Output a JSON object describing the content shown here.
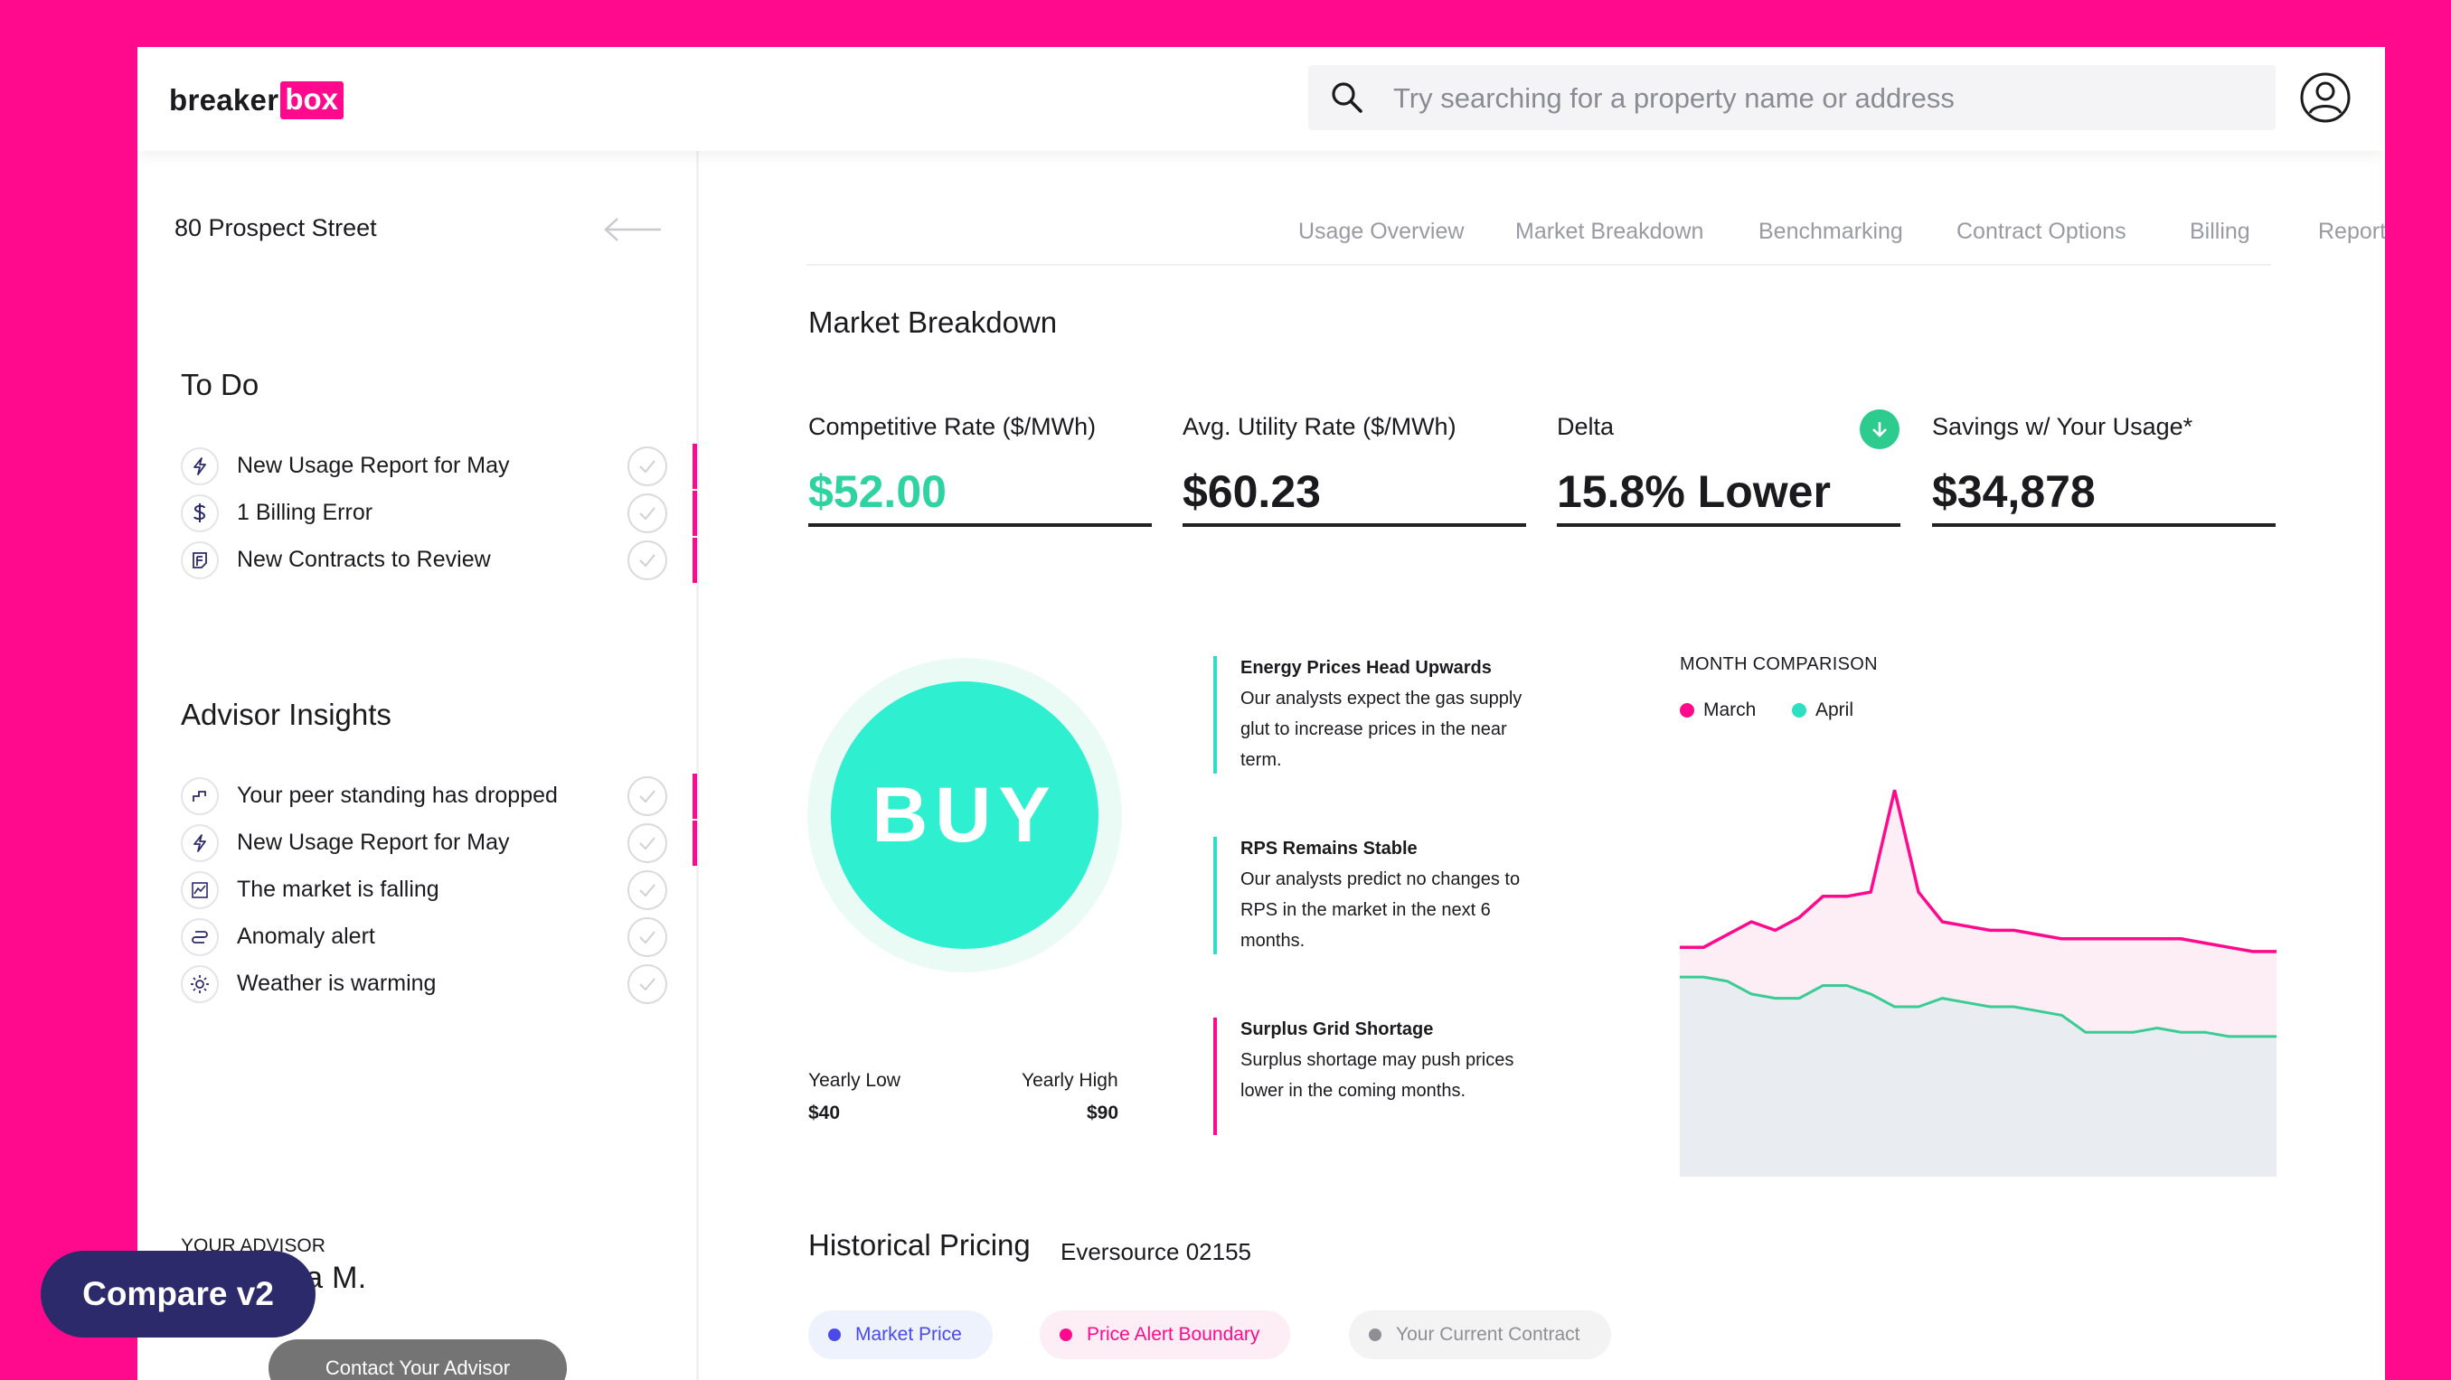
{
  "brand": {
    "logo_part1": "breaker",
    "logo_part2": "box",
    "accent": "#FF0A8C"
  },
  "search": {
    "placeholder": "Try searching for a property name or address"
  },
  "sidebar": {
    "property": "80 Prospect Street",
    "todo": {
      "title": "To Do",
      "items": [
        {
          "label": "New Usage Report for May",
          "icon": "lightning-icon",
          "flagged": true
        },
        {
          "label": "1 Billing Error",
          "icon": "dollar-icon",
          "flagged": true
        },
        {
          "label": "New Contracts to Review",
          "icon": "document-icon",
          "flagged": true
        }
      ]
    },
    "insights": {
      "title": "Advisor Insights",
      "items": [
        {
          "label": "Your peer standing has dropped",
          "icon": "steps-icon",
          "flagged": true
        },
        {
          "label": "New Usage Report for May",
          "icon": "lightning-icon",
          "flagged": true
        },
        {
          "label": "The market is falling",
          "icon": "trend-chart-icon",
          "flagged": false
        },
        {
          "label": "Anomaly alert",
          "icon": "anomaly-icon",
          "flagged": false
        },
        {
          "label": "Weather is warming",
          "icon": "sun-icon",
          "flagged": false
        }
      ]
    },
    "advisor": {
      "label": "YOUR ADVISOR",
      "name": "Samantha M.",
      "contact_label": "Contact Your Advisor"
    }
  },
  "tabs": [
    "Usage Overview",
    "Market Breakdown",
    "Benchmarking",
    "Contract Options",
    "Billing",
    "Reports"
  ],
  "main": {
    "title": "Market Breakdown",
    "metrics": [
      {
        "label": "Competitive Rate ($/MWh)",
        "value": "$52.00"
      },
      {
        "label": "Avg. Utility Rate ($/MWh)",
        "value": "$60.23"
      },
      {
        "label": "Delta",
        "value": "15.8% Lower"
      },
      {
        "label": "Savings w/ Your Usage*",
        "value": "$34,878"
      }
    ],
    "buy": {
      "label": "BUY",
      "yearly_low_label": "Yearly Low",
      "yearly_low": "$40",
      "yearly_high_label": "Yearly High",
      "yearly_high": "$90"
    },
    "insights": [
      {
        "title": "Energy Prices Head Upwards",
        "body": "Our analysts expect the gas supply glut to increase prices in the near term.",
        "color": "#2EE0C1"
      },
      {
        "title": "RPS Remains Stable",
        "body": "Our analysts predict no changes to RPS in the market in the next 6 months.",
        "color": "#2EE0C1"
      },
      {
        "title": "Surplus Grid Shortage",
        "body": "Surplus shortage may push prices lower in the coming months.",
        "color": "#FF0A8C"
      }
    ]
  },
  "chart_data": {
    "type": "area",
    "title": "MONTH COMPARISON",
    "legend_placement": "top-left",
    "grid": false,
    "series": [
      {
        "name": "March",
        "color": "#FF0A8C",
        "values": [
          54,
          54,
          57,
          60,
          58,
          61,
          66,
          66,
          67,
          91,
          67,
          60,
          59,
          58,
          58,
          57,
          56,
          56,
          56,
          56,
          56,
          56,
          55,
          54,
          53,
          53
        ]
      },
      {
        "name": "April",
        "color": "#3BCB94",
        "values": [
          47,
          47,
          46,
          43,
          42,
          42,
          45,
          45,
          43,
          40,
          40,
          42,
          41,
          40,
          40,
          39,
          38,
          34,
          34,
          34,
          35,
          34,
          34,
          33,
          33,
          33
        ]
      }
    ],
    "ylim": [
      0,
      100
    ]
  },
  "historical": {
    "title": "Historical Pricing",
    "subtitle": "Eversource 02155",
    "pills": [
      {
        "label": "Market Price",
        "color": "#4A4AE8",
        "bg": "#EEF2FD"
      },
      {
        "label": "Price Alert Boundary",
        "color": "#FF0A8C",
        "bg": "#FDEEF5"
      },
      {
        "label": "Your Current Contract",
        "color": "#8E8E95",
        "bg": "#F3F3F4"
      }
    ]
  },
  "overlay": {
    "label": "Compare v2"
  }
}
